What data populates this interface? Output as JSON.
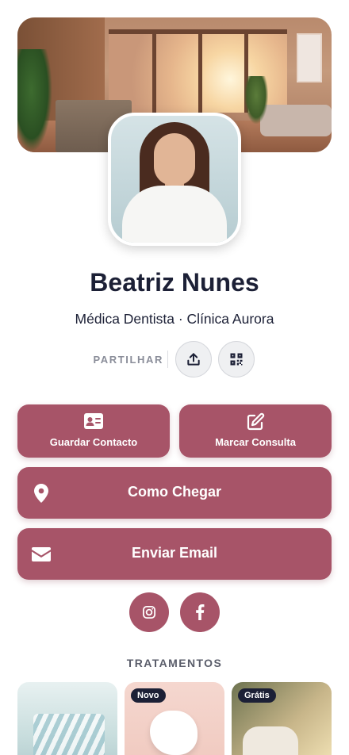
{
  "profile": {
    "name": "Beatriz Nunes",
    "subtitle": "Médica Dentista · Clínica Aurora"
  },
  "share": {
    "label": "PARTILHAR",
    "upload_icon": "upload-icon",
    "qr_icon": "qr-code-icon"
  },
  "actions": {
    "save_contact": "Guardar Contacto",
    "book_appointment": "Marcar Consulta",
    "directions": "Como Chegar",
    "send_email": "Enviar Email"
  },
  "social": [
    "instagram-icon",
    "facebook-icon"
  ],
  "treatments": {
    "title": "TRATAMENTOS",
    "cards": [
      {
        "badge": ""
      },
      {
        "badge": "Novo"
      },
      {
        "badge": "Grátis"
      }
    ]
  },
  "colors": {
    "accent": "#a75468",
    "text_dark": "#1c2036",
    "badge_bg": "#1c2036"
  }
}
